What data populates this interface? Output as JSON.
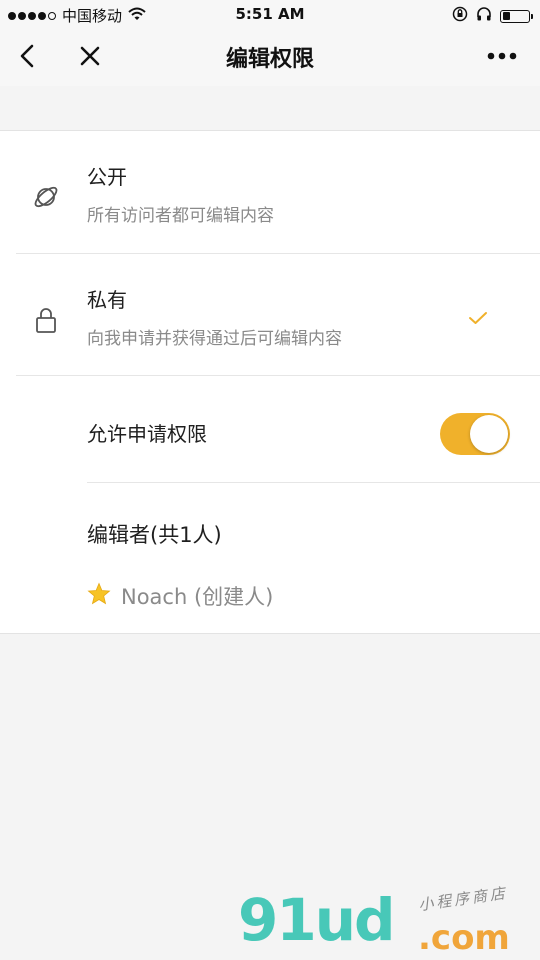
{
  "status_bar": {
    "carrier": "中国移动",
    "time": "5:51 AM"
  },
  "nav": {
    "title": "编辑权限"
  },
  "options": [
    {
      "title": "公开",
      "subtitle": "所有访问者都可编辑内容",
      "icon": "public-orbit-icon",
      "selected": false
    },
    {
      "title": "私有",
      "subtitle": "向我申请并获得通过后可编辑内容",
      "icon": "lock-icon",
      "selected": true
    }
  ],
  "allow_request": {
    "label": "允许申请权限",
    "enabled": true
  },
  "editors": {
    "header": "编辑者(共1人)",
    "items": [
      {
        "name": "Noach (创建人)",
        "icon": "star-icon"
      }
    ]
  },
  "watermark": {
    "big": "91ud",
    "domain": ".com",
    "small": "小程序商店"
  },
  "colors": {
    "accent": "#f0b12b",
    "watermark_teal": "#48c8b8",
    "watermark_orange": "#f0a53a"
  }
}
